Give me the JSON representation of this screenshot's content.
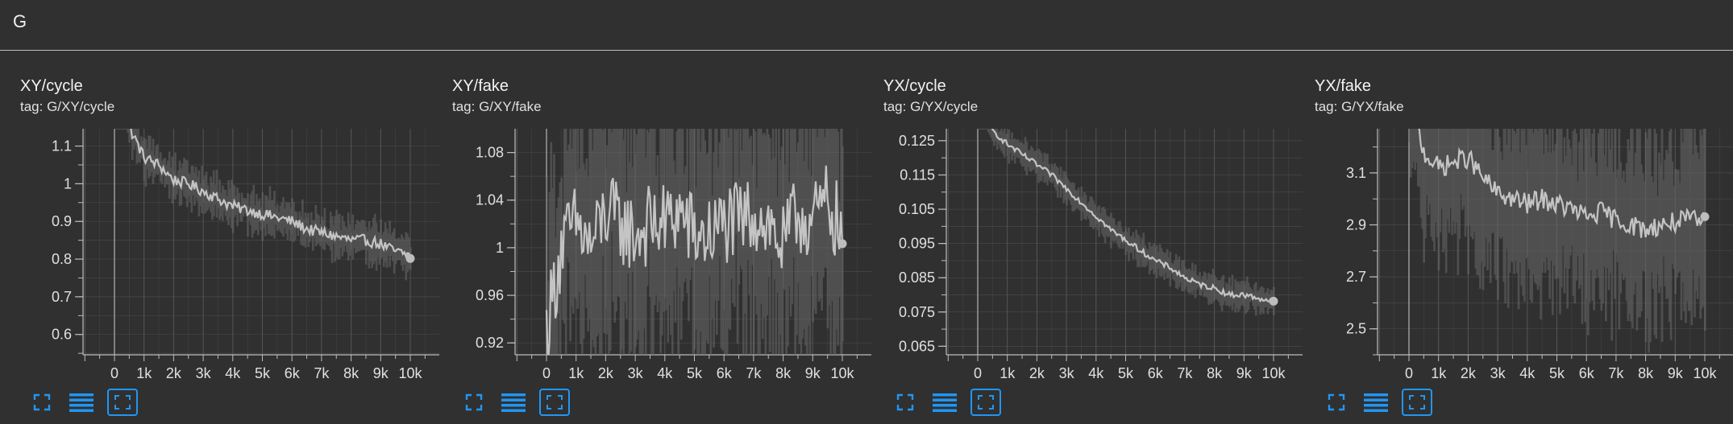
{
  "group": {
    "title": "G"
  },
  "colors": {
    "background": "#303030",
    "plot_bg": "#2f2f2f",
    "grid": "#5a5a5a",
    "line": "#c4c4c4",
    "raw_band": "#6a6a6a",
    "axis": "#bdbdbd",
    "icon_accent": "#2196f3"
  },
  "toolbar_icons": [
    "fullscreen-icon",
    "toggle-log-scale-icon",
    "fit-domain-icon"
  ],
  "cards": [
    {
      "title": "XY/cycle",
      "tag": "tag: G/XY/cycle"
    },
    {
      "title": "XY/fake",
      "tag": "tag: G/XY/fake"
    },
    {
      "title": "YX/cycle",
      "tag": "tag: G/YX/cycle"
    },
    {
      "title": "YX/fake",
      "tag": "tag: G/YX/fake"
    }
  ],
  "chart_data": [
    {
      "type": "line",
      "xlabel": "",
      "ylabel": "",
      "xlim": [
        -1050,
        10950
      ],
      "ylim": [
        0.546,
        1.146
      ],
      "xticks": [
        0,
        1000,
        2000,
        3000,
        4000,
        5000,
        6000,
        7000,
        8000,
        9000,
        10000
      ],
      "xtick_labels": [
        "0",
        "1k",
        "2k",
        "3k",
        "4k",
        "5k",
        "6k",
        "7k",
        "8k",
        "9k",
        "10k"
      ],
      "yticks": [
        0.6,
        0.7,
        0.8,
        0.9,
        1.0,
        1.1
      ],
      "ytick_labels": [
        "0.6",
        "0.7",
        "0.8",
        "0.9",
        "1",
        "1.1"
      ],
      "grid": true,
      "series": [
        {
          "x": [
            0,
            500,
            1000,
            1500,
            2000,
            2500,
            3000,
            3500,
            4000,
            4500,
            5000,
            5500,
            6000,
            6500,
            7000,
            7500,
            8000,
            8500,
            9000,
            9500,
            10000
          ],
          "y": [
            1.5,
            1.15,
            1.07,
            1.05,
            1.01,
            1.0,
            0.98,
            0.96,
            0.94,
            0.93,
            0.92,
            0.91,
            0.9,
            0.88,
            0.87,
            0.86,
            0.85,
            0.85,
            0.84,
            0.82,
            0.81
          ],
          "noise": 0.015,
          "band": 0.05
        }
      ]
    },
    {
      "type": "line",
      "xlabel": "",
      "ylabel": "",
      "xlim": [
        -1050,
        10950
      ],
      "ylim": [
        0.91,
        1.1
      ],
      "xticks": [
        0,
        1000,
        2000,
        3000,
        4000,
        5000,
        6000,
        7000,
        8000,
        9000,
        10000
      ],
      "xtick_labels": [
        "0",
        "1k",
        "2k",
        "3k",
        "4k",
        "5k",
        "6k",
        "7k",
        "8k",
        "9k",
        "10k"
      ],
      "yticks": [
        0.92,
        0.96,
        1.0,
        1.04,
        1.08
      ],
      "ytick_labels": [
        "0.92",
        "0.96",
        "1",
        "1.04",
        "1.08"
      ],
      "grid": true,
      "series": [
        {
          "x": [
            0,
            500,
            1000,
            1500,
            2000,
            2500,
            3000,
            3500,
            4000,
            4500,
            5000,
            5500,
            6000,
            6500,
            7000,
            7500,
            8000,
            8500,
            9000,
            9500,
            10000
          ],
          "y": [
            0.93,
            1.0,
            1.02,
            1.0,
            1.03,
            1.02,
            1.01,
            1.02,
            1.02,
            1.03,
            1.01,
            1.01,
            1.02,
            1.02,
            1.03,
            1.02,
            1.0,
            1.03,
            1.02,
            1.04,
            1.01
          ],
          "noise": 0.035,
          "band": 0.1
        }
      ]
    },
    {
      "type": "line",
      "xlabel": "",
      "ylabel": "",
      "xlim": [
        -1050,
        10950
      ],
      "ylim": [
        0.0625,
        0.1285
      ],
      "xticks": [
        0,
        1000,
        2000,
        3000,
        4000,
        5000,
        6000,
        7000,
        8000,
        9000,
        10000
      ],
      "xtick_labels": [
        "0",
        "1k",
        "2k",
        "3k",
        "4k",
        "5k",
        "6k",
        "7k",
        "8k",
        "9k",
        "10k"
      ],
      "yticks": [
        0.065,
        0.075,
        0.085,
        0.095,
        0.105,
        0.115,
        0.125
      ],
      "ytick_labels": [
        "0.065",
        "0.075",
        "0.085",
        "0.095",
        "0.105",
        "0.115",
        "0.125"
      ],
      "grid": true,
      "series": [
        {
          "x": [
            0,
            500,
            1000,
            1500,
            2000,
            2500,
            3000,
            3500,
            4000,
            4500,
            5000,
            5500,
            6000,
            6500,
            7000,
            7500,
            8000,
            8500,
            9000,
            9500,
            10000
          ],
          "y": [
            0.14,
            0.128,
            0.124,
            0.121,
            0.118,
            0.115,
            0.111,
            0.107,
            0.103,
            0.099,
            0.096,
            0.093,
            0.09,
            0.088,
            0.085,
            0.083,
            0.082,
            0.08,
            0.08,
            0.079,
            0.078
          ],
          "noise": 0.0008,
          "band": 0.004
        }
      ]
    },
    {
      "type": "line",
      "xlabel": "",
      "ylabel": "",
      "xlim": [
        -1050,
        10950
      ],
      "ylim": [
        2.4,
        3.27
      ],
      "xticks": [
        0,
        1000,
        2000,
        3000,
        4000,
        5000,
        6000,
        7000,
        8000,
        9000,
        10000
      ],
      "xtick_labels": [
        "0",
        "1k",
        "2k",
        "3k",
        "4k",
        "5k",
        "6k",
        "7k",
        "8k",
        "9k",
        "10k"
      ],
      "yticks": [
        2.5,
        2.7,
        2.9,
        3.1
      ],
      "ytick_labels": [
        "2.5",
        "2.7",
        "2.9",
        "3.1"
      ],
      "grid": true,
      "series": [
        {
          "x": [
            0,
            500,
            1000,
            1500,
            2000,
            2500,
            3000,
            3500,
            4000,
            4500,
            5000,
            5500,
            6000,
            6500,
            7000,
            7500,
            8000,
            8500,
            9000,
            9500,
            10000
          ],
          "y": [
            3.4,
            3.18,
            3.12,
            3.14,
            3.16,
            3.08,
            3.02,
            3.0,
            2.98,
            3.0,
            2.98,
            2.96,
            2.93,
            2.95,
            2.92,
            2.9,
            2.88,
            2.9,
            2.91,
            2.92,
            2.91
          ],
          "noise": 0.04,
          "band": 0.35
        }
      ]
    }
  ]
}
